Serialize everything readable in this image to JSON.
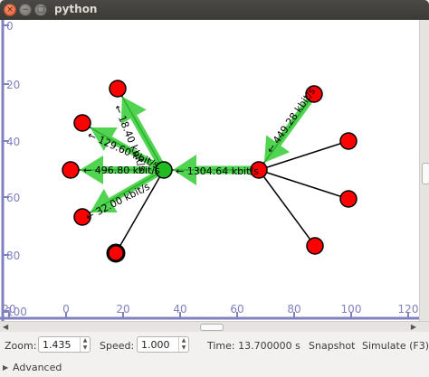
{
  "window": {
    "title": "python",
    "close_glyph": "×",
    "minimize_glyph": "−",
    "maximize_glyph": "□"
  },
  "canvas": {
    "background": "#ffffff",
    "axis_color": "#8080c0",
    "y_ticks": [
      "0",
      "20",
      "40",
      "60",
      "80",
      "100"
    ],
    "x_ticks": [
      "20",
      "0",
      "20",
      "40",
      "60",
      "80",
      "100",
      "120"
    ],
    "link_color": "#000000",
    "flow_arrow_color": "#33cc33",
    "node_color": "#ff0000",
    "active_node_color": "#22bb22",
    "links": [
      {
        "from": "hub-left",
        "to": "n-top"
      },
      {
        "from": "hub-left",
        "to": "n-upper-left"
      },
      {
        "from": "hub-left",
        "to": "n-left"
      },
      {
        "from": "hub-left",
        "to": "n-lower-left"
      },
      {
        "from": "hub-left",
        "to": "n-bottom"
      },
      {
        "from": "hub-right",
        "to": "hub-left"
      },
      {
        "from": "hub-right",
        "to": "n-top-right"
      },
      {
        "from": "hub-right",
        "to": "n-right-1"
      },
      {
        "from": "hub-right",
        "to": "n-right-2"
      },
      {
        "from": "hub-right",
        "to": "n-bottom-right"
      }
    ],
    "flows": [
      {
        "label": "← 18.40 kbit/s"
      },
      {
        "label": "← 129.60 kbit/s"
      },
      {
        "label": "← 496.80 kbit/s"
      },
      {
        "label": "← 32.00 kbit/s"
      },
      {
        "label": "← 1304.64 kbit/s"
      },
      {
        "label": "← 449.28 kbit/s"
      }
    ]
  },
  "toolbar": {
    "zoom_label": "Zoom:",
    "zoom_value": "1.435",
    "speed_label": "Speed:",
    "speed_value": "1.000",
    "time_text": "Time: 13.700000 s",
    "snapshot_label": "Snapshot",
    "simulate_label": "Simulate (F3)",
    "spin_up": "▲",
    "spin_down": "▼"
  },
  "advanced": {
    "label": "Advanced",
    "arrow": "▶"
  },
  "scroll": {
    "left_arrow": "◀",
    "right_arrow": "▶"
  }
}
